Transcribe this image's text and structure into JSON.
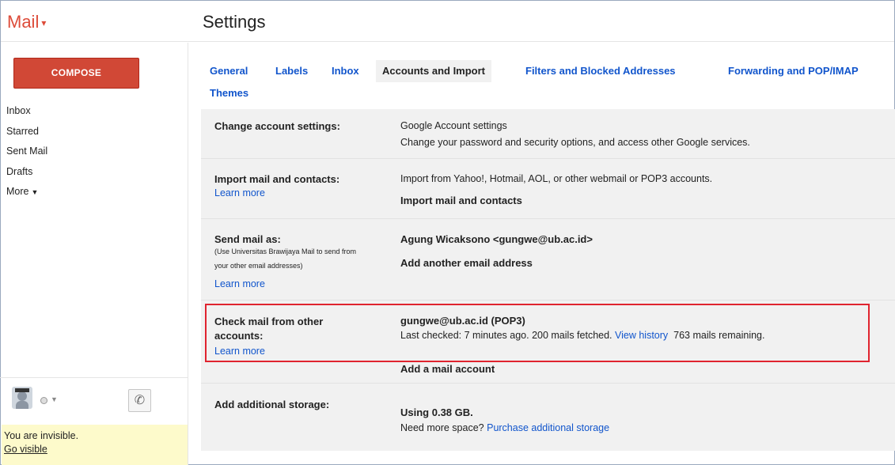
{
  "header": {
    "app_name": "Mail",
    "page_title": "Settings"
  },
  "sidebar": {
    "compose_label": "COMPOSE",
    "items": [
      {
        "label": "Inbox"
      },
      {
        "label": "Starred"
      },
      {
        "label": "Sent Mail"
      },
      {
        "label": "Drafts"
      },
      {
        "label": "More"
      }
    ]
  },
  "chat": {
    "status_text": "You are invisible.",
    "go_visible_label": "Go visible"
  },
  "tabs": [
    {
      "label": "General"
    },
    {
      "label": "Labels"
    },
    {
      "label": "Inbox"
    },
    {
      "label": "Accounts and Import",
      "active": true
    },
    {
      "label": "Filters and Blocked Addresses"
    },
    {
      "label": "Forwarding and POP/IMAP"
    },
    {
      "label": "Themes"
    }
  ],
  "sections": {
    "change_account": {
      "label": "Change account settings:",
      "link": "Google Account settings",
      "description": "Change your password and security options, and access other Google services."
    },
    "import": {
      "label": "Import mail and contacts:",
      "learn_more": "Learn more",
      "description": "Import from Yahoo!, Hotmail, AOL, or other webmail or POP3 accounts.",
      "action": "Import mail and contacts"
    },
    "send_as": {
      "label": "Send mail as:",
      "note_line1": "(Use Universitas Brawijaya Mail to send from",
      "note_line2": "your other email addresses)",
      "learn_more": "Learn more",
      "account": "Agung Wicaksono <gungwe@ub.ac.id>",
      "action": "Add another email address"
    },
    "check_mail": {
      "label_line1": "Check mail from other",
      "label_line2": "accounts:",
      "learn_more": "Learn more",
      "account": "gungwe@ub.ac.id (POP3)",
      "status": "Last checked: 7 minutes ago. 200 mails fetched.",
      "history_link": "View history",
      "remaining": "763 mails remaining.",
      "action": "Add a mail account"
    },
    "storage": {
      "label": "Add additional storage:",
      "usage": "Using 0.38 GB.",
      "prompt": "Need more space?",
      "link": "Purchase additional storage"
    }
  },
  "colors": {
    "brand_red": "#dd4b39",
    "compose_red": "#d14836",
    "link_blue": "#1155cc",
    "highlight_red": "#e0242f"
  }
}
